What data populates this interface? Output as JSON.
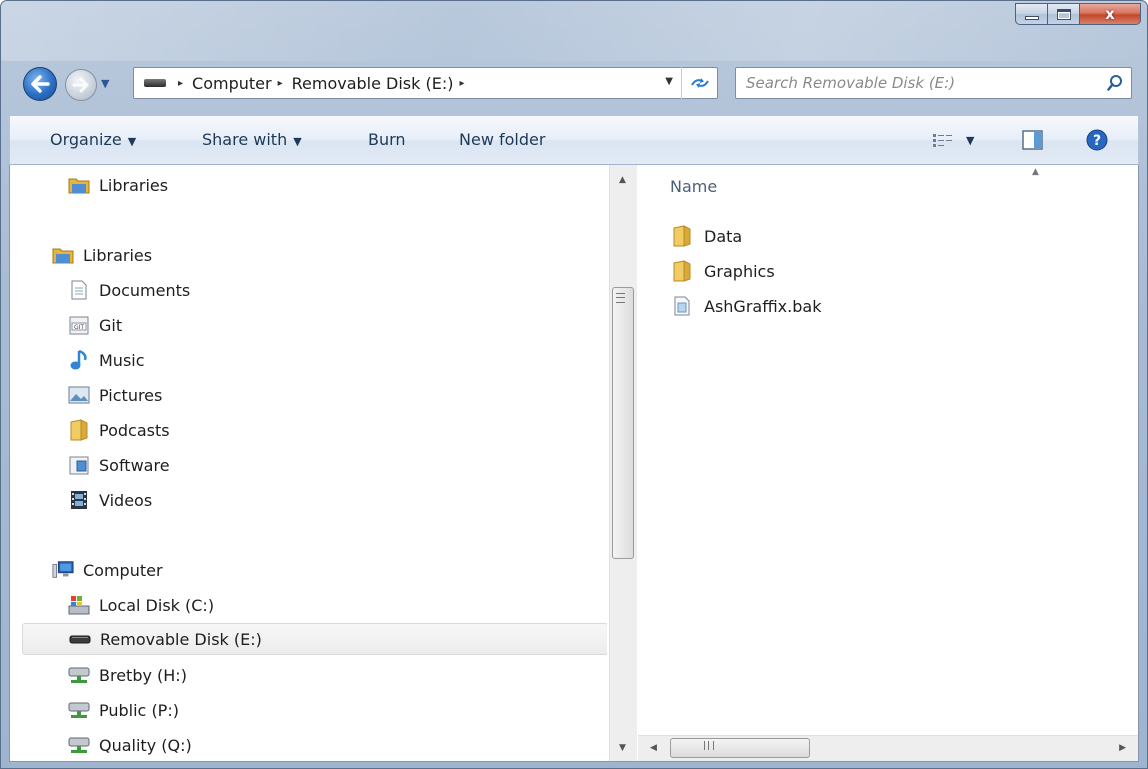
{
  "window": {
    "caption": {
      "minimize_icon": "minimize-icon",
      "maximize_icon": "maximize-icon",
      "close_glyph": "x"
    }
  },
  "navigation": {
    "back_icon": "back-arrow-icon",
    "forward_icon": "forward-arrow-icon",
    "address": {
      "crumbs": [
        "Computer",
        "Removable Disk (E:)"
      ],
      "separator": "▸"
    },
    "search": {
      "placeholder": "Search Removable Disk (E:)"
    }
  },
  "toolbar": {
    "organize": "Organize",
    "share_with": "Share with",
    "burn": "Burn",
    "new_folder": "New folder"
  },
  "nav_pane": {
    "items": [
      {
        "label": "Libraries",
        "icon": "libraries-icon"
      },
      {
        "label": "Libraries",
        "icon": "libraries-icon"
      },
      {
        "label": "Documents",
        "icon": "documents-icon"
      },
      {
        "label": "Git",
        "icon": "git-library-icon"
      },
      {
        "label": "Music",
        "icon": "music-icon"
      },
      {
        "label": "Pictures",
        "icon": "pictures-icon"
      },
      {
        "label": "Podcasts",
        "icon": "folder-icon"
      },
      {
        "label": "Software",
        "icon": "software-library-icon"
      },
      {
        "label": "Videos",
        "icon": "videos-icon"
      },
      {
        "label": "Computer",
        "icon": "computer-icon"
      },
      {
        "label": "Local Disk (C:)",
        "icon": "local-disk-icon"
      },
      {
        "label": "Removable Disk (E:)",
        "icon": "removable-disk-icon",
        "selected": true
      },
      {
        "label": "Bretby (H:)",
        "icon": "network-drive-icon"
      },
      {
        "label": "Public (P:)",
        "icon": "network-drive-icon"
      },
      {
        "label": "Quality (Q:)",
        "icon": "network-drive-icon"
      }
    ]
  },
  "file_list": {
    "column_header": "Name",
    "items": [
      {
        "name": "Data",
        "icon": "folder-icon"
      },
      {
        "name": "Graphics",
        "icon": "folder-icon"
      },
      {
        "name": "AshGraffix.bak",
        "icon": "file-icon"
      }
    ]
  },
  "colors": {
    "accent": "#2a6fc4",
    "folder": "#e8b83a",
    "selection": "#ececec"
  }
}
